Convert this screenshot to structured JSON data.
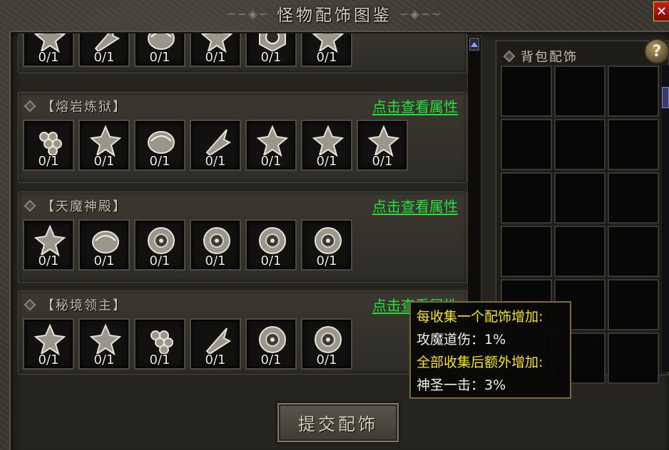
{
  "window": {
    "title": "怪物配饰图鉴",
    "title_left_ornament": "~∽◈∽",
    "title_right_ornament": "∽◈∽~",
    "close_label": "✕"
  },
  "categories": [
    {
      "name": "",
      "link": "",
      "items": [
        {
          "icon": "lotus-icon",
          "count": "0/1"
        },
        {
          "icon": "bell-icon",
          "count": "0/1"
        },
        {
          "icon": "pot-icon",
          "count": "0/1"
        },
        {
          "icon": "knot-icon",
          "count": "0/1"
        },
        {
          "icon": "yinyang-icon",
          "count": "0/1"
        },
        {
          "icon": "scroll-icon",
          "count": "0/1"
        }
      ]
    },
    {
      "name": "【熔岩炼狱】",
      "link": "点击查看属性",
      "items": [
        {
          "icon": "scales-icon",
          "count": "0/1"
        },
        {
          "icon": "beetle-icon",
          "count": "0/1"
        },
        {
          "icon": "shell-icon",
          "count": "0/1"
        },
        {
          "icon": "arrow-icon",
          "count": "0/1"
        },
        {
          "icon": "wing-icon",
          "count": "0/1"
        },
        {
          "icon": "flower-icon",
          "count": "0/1"
        },
        {
          "icon": "ring-icon",
          "count": "0/1"
        }
      ]
    },
    {
      "name": "【天魔神殿】",
      "link": "点击查看属性",
      "items": [
        {
          "icon": "claw-icon",
          "count": "0/1"
        },
        {
          "icon": "orb-icon",
          "count": "0/1"
        },
        {
          "icon": "disc-icon",
          "count": "0/1"
        },
        {
          "icon": "disc-icon",
          "count": "0/1"
        },
        {
          "icon": "disc-icon",
          "count": "0/1"
        },
        {
          "icon": "disc-icon",
          "count": "0/1"
        }
      ]
    },
    {
      "name": "【秘境领主】",
      "link": "点击查看属性",
      "items": [
        {
          "icon": "spider-icon",
          "count": "0/1"
        },
        {
          "icon": "flame-icon",
          "count": "0/1"
        },
        {
          "icon": "grape-icon",
          "count": "0/1"
        },
        {
          "icon": "feather-icon",
          "count": "0/1"
        },
        {
          "icon": "medallion-icon",
          "count": "0/1"
        },
        {
          "icon": "wheel-icon",
          "count": "0/1"
        }
      ]
    }
  ],
  "bag": {
    "title": "背包配饰",
    "help_label": "?",
    "slot_count": 18
  },
  "tooltip": {
    "line1": "每收集一个配饰增加:",
    "line2": "攻魔道伤：1%",
    "line3": "全部收集后额外增加:",
    "line4": "神圣一击：3%"
  },
  "submit_label": "提交配饰",
  "colors": {
    "link_green": "#22e03b",
    "tooltip_yellow": "#f4e417",
    "close_red": "#c81d14"
  }
}
